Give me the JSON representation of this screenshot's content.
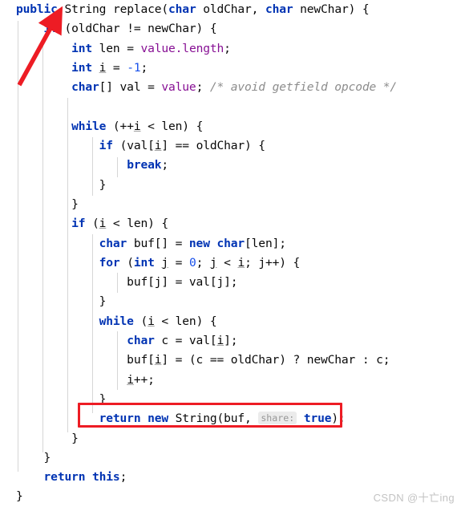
{
  "editor": {
    "language": "java",
    "background_color": "#ffffff",
    "font_size_px": 14.6,
    "line_height_px": 24.3,
    "colors": {
      "keyword": "#0033b3",
      "field": "#871094",
      "number": "#1750eb",
      "comment": "#8c8c8c",
      "plain": "#080808",
      "indent_guide": "#d6d6d6",
      "inlay_hint_bg": "#ebebeb",
      "inlay_hint_fg": "#989898",
      "annotation_red": "#ed1c24",
      "watermark": "#c3c3c3"
    }
  },
  "code": {
    "lines": [
      "public String replace(char oldChar, char newChar) {",
      "    if (oldChar != newChar) {",
      "        int len = value.length;",
      "        int i = -1;",
      "        char[] val = value; /* avoid getfield opcode */",
      "",
      "        while (++i < len) {",
      "            if (val[i] == oldChar) {",
      "                break;",
      "            }",
      "        }",
      "        if (i < len) {",
      "            char buf[] = new char[len];",
      "            for (int j = 0; j < i; j++) {",
      "                buf[j] = val[j];",
      "            }",
      "            while (i < len) {",
      "                char c = val[i];",
      "                buf[i] = (c == oldChar) ? newChar : c;",
      "                i++;",
      "            }",
      "            return new String(buf, true);",
      "        }",
      "    }",
      "    return this;",
      "}"
    ],
    "inlay_hints": [
      {
        "line_index": 21,
        "label": "share:"
      }
    ]
  },
  "annotations": {
    "arrow": {
      "name": "red-arrow",
      "color": "#ed1c24",
      "points_to_line_index": 1,
      "points_to_token": "if"
    },
    "highlight_box": {
      "name": "red-highlight-box",
      "color": "#ed1c24",
      "line_index": 21,
      "highlighted_text": "return new String(buf, share: true);"
    }
  },
  "watermark": {
    "text": "CSDN @十亡ing"
  }
}
